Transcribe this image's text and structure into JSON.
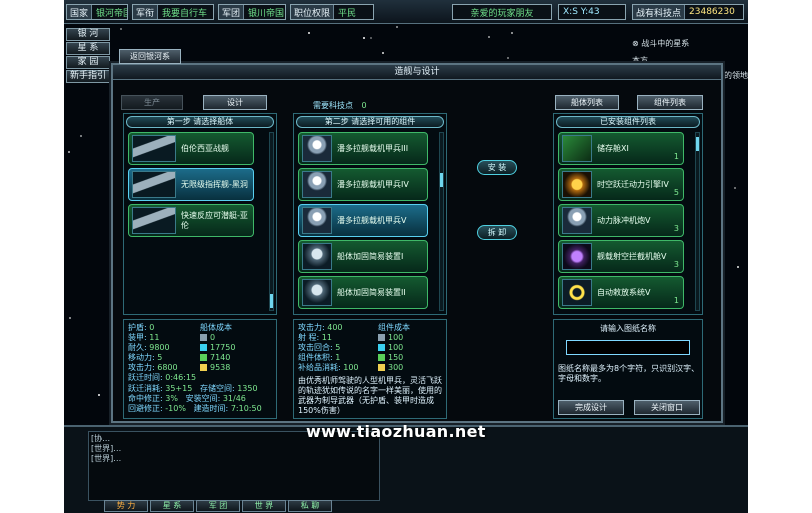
{
  "topbar": {
    "country_key": "国家",
    "country_val": "银河帝国",
    "rank_key": "军衔",
    "rank_val": "我要自行车",
    "army_key": "军团",
    "army_val": "银川帝国",
    "post_key": "职位权限",
    "post_val": "平民",
    "player_name": "亲爱的玩家朋友",
    "coords": "X:S Y:43",
    "points_key": "战有科技点",
    "points_val": "23486230"
  },
  "left_nav": [
    "银 河",
    "星 系",
    "家 园",
    "新手指引"
  ],
  "map_right": {
    "legend_1": "战斗中的星系",
    "legend_2": "本方…",
    "legend_3": "的领地"
  },
  "dialog": {
    "title": "造舰与设计",
    "back_button": "返回银河系",
    "tab_produce": "生产",
    "tab_design": "设计",
    "tech_points_label": "需要科技点",
    "tech_points_value": "0",
    "btn_ship_list": "船体列表",
    "btn_comp_list": "组件列表",
    "btn_install": "安 装",
    "btn_remove": "拆 卸",
    "btn_finish": "完成设计",
    "btn_close": "关闭窗口"
  },
  "hull_pane": {
    "header": "第一步 请选择船体",
    "items": [
      {
        "name": "伯伦西亚战舰",
        "selected": false
      },
      {
        "name": "无限级指挥舰-黑洞",
        "selected": true
      },
      {
        "name": "快速反应可潜艇-亚伦",
        "selected": false
      }
    ]
  },
  "comp_pane": {
    "header": "第二步 请选择可用的组件",
    "items": [
      {
        "name": "潘多拉舰载机甲兵III",
        "icon": "mech",
        "selected": false
      },
      {
        "name": "潘多拉舰载机甲兵IV",
        "icon": "mech",
        "selected": false
      },
      {
        "name": "潘多拉舰载机甲兵V",
        "icon": "mech",
        "selected": true
      },
      {
        "name": "船体加固简易装置I",
        "icon": "armor",
        "selected": false
      },
      {
        "name": "船体加固简易装置II",
        "icon": "armor",
        "selected": false
      }
    ]
  },
  "installed_pane": {
    "header": "已安装组件列表",
    "items": [
      {
        "name": "储存舱XI",
        "count": "1",
        "icon": "green"
      },
      {
        "name": "时空跃迁动力引擎IV",
        "count": "5",
        "icon": "gold"
      },
      {
        "name": "动力脉冲机炮V",
        "count": "3",
        "icon": "mech"
      },
      {
        "name": "舰载射空拦截机舱V",
        "count": "3",
        "icon": "purple"
      },
      {
        "name": "自动敕放系统V",
        "count": "1",
        "icon": "ring"
      }
    ]
  },
  "ship_stats": {
    "rows": [
      {
        "label": "护盾:",
        "value": "0"
      },
      {
        "label": "装甲:",
        "value": "11"
      },
      {
        "label": "耐久:",
        "value": "9800"
      },
      {
        "label": "移动力:",
        "value": "5"
      },
      {
        "label": "攻击力:",
        "value": "6800"
      },
      {
        "label": "跃迁时间:",
        "value": "0:46:15"
      }
    ],
    "cost_label": "船体成本",
    "costs": [
      "0",
      "17750",
      "7140",
      "9538"
    ],
    "extra": [
      {
        "label": "跃迁消耗:",
        "value": "35+15",
        "label2": "存储空间:",
        "value2": "1350"
      },
      {
        "label": "命中修正:",
        "value": "3%",
        "label2": "安装空间:",
        "value2": "31/46"
      },
      {
        "label": "回避修正:",
        "value": "-10%",
        "label2": "建造时间:",
        "value2": "7:10:50"
      }
    ]
  },
  "comp_stats": {
    "rows": [
      {
        "label": "攻击力:",
        "value": "400"
      },
      {
        "label": "射 程:",
        "value": "11"
      },
      {
        "label": "攻击回合:",
        "value": "5"
      },
      {
        "label": "组件体积:",
        "value": "1"
      },
      {
        "label": "补给品消耗:",
        "value": "100"
      }
    ],
    "cost_label": "组件成本",
    "costs": [
      "100",
      "100",
      "150",
      "300"
    ],
    "description": "由优秀机师驾驶的人型机甲兵，灵活飞跃的轨迹犹如传说的名字一样美丽，使用的武器为制导武器（无护盾、装甲时造成150%伤害）"
  },
  "blueprint": {
    "label": "请输入图纸名称",
    "input_value": "",
    "hint": "图纸名称最多为8个字符，只识别汉字、字母和数字。"
  },
  "chat": {
    "lines": [
      "[协…",
      "[世界]…",
      "[世界]…"
    ],
    "tabs": [
      "势 力",
      "星 系",
      "军 团",
      "世 界",
      "私 聊"
    ]
  },
  "watermark": "www.tiaozhuan.net",
  "colors": {
    "accent_cyan": "#7fd8ff",
    "item_green": "#3fb868",
    "value_green": "#7fe890",
    "highlight_yellow": "#ffe680"
  }
}
